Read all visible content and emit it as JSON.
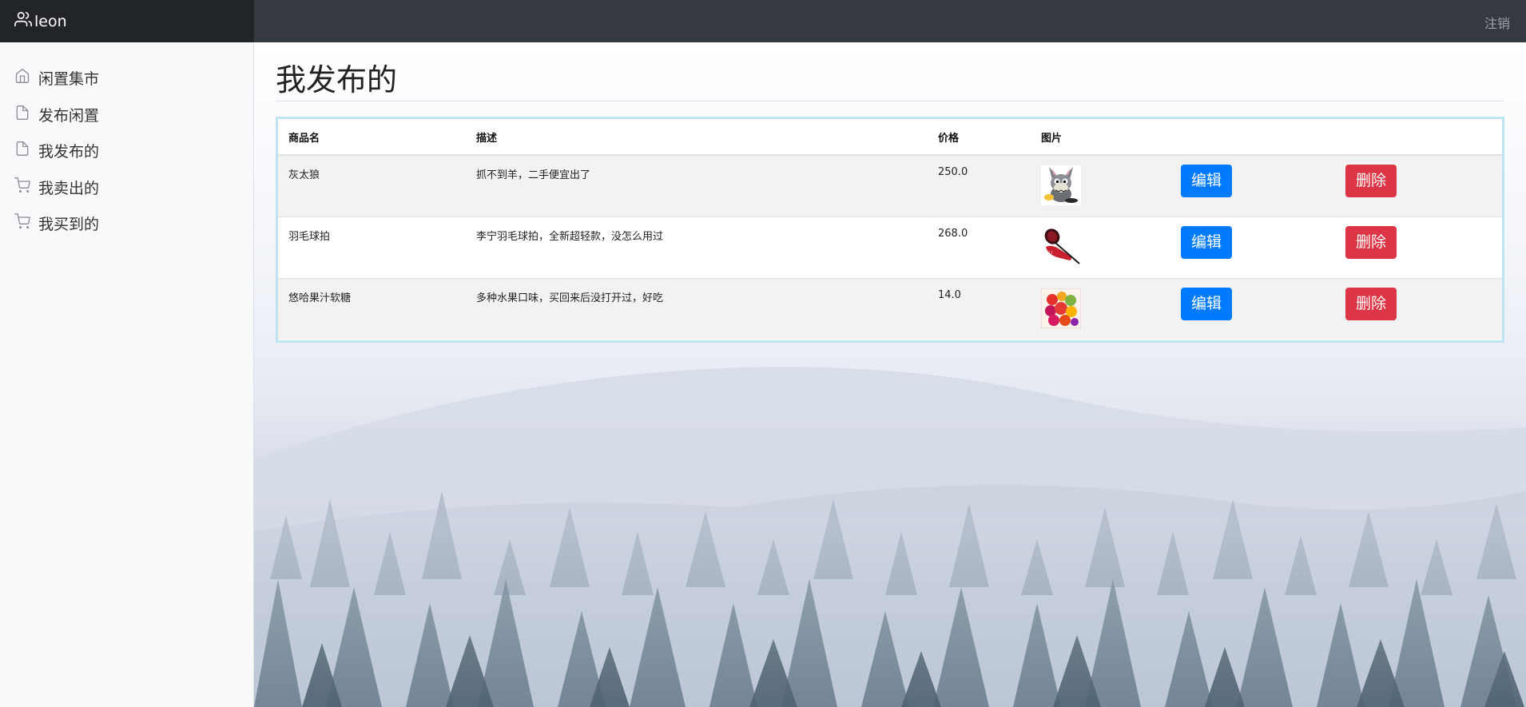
{
  "app": {
    "username": "leon",
    "logout_label": "注销",
    "icon": "users-icon"
  },
  "sidebar": {
    "items": [
      {
        "label": "闲置集市",
        "icon": "home-icon"
      },
      {
        "label": "发布闲置",
        "icon": "file-icon"
      },
      {
        "label": "我发布的",
        "icon": "file-icon"
      },
      {
        "label": "我卖出的",
        "icon": "cart-icon"
      },
      {
        "label": "我买到的",
        "icon": "cart-icon"
      }
    ]
  },
  "main": {
    "title": "我发布的",
    "table": {
      "headers": [
        "商品名",
        "描述",
        "价格",
        "图片"
      ],
      "edit_label": "编辑",
      "delete_label": "删除",
      "rows": [
        {
          "name": "灰太狼",
          "desc": "抓不到羊，二手便宜出了",
          "price": "250.0",
          "image": "wolf-image"
        },
        {
          "name": "羽毛球拍",
          "desc": "李宁羽毛球拍，全新超轻款，没怎么用过",
          "price": "268.0",
          "image": "racket-image"
        },
        {
          "name": "悠哈果汁软糖",
          "desc": "多种水果口味，买回来后没打开过，好吃",
          "price": "14.0",
          "image": "candy-image"
        }
      ]
    }
  },
  "colors": {
    "topbar": "#343a40",
    "brand_bg": "#212529",
    "edit_button": "#007bff",
    "delete_button": "#dc3545",
    "table_border": "#bfe4f1"
  }
}
